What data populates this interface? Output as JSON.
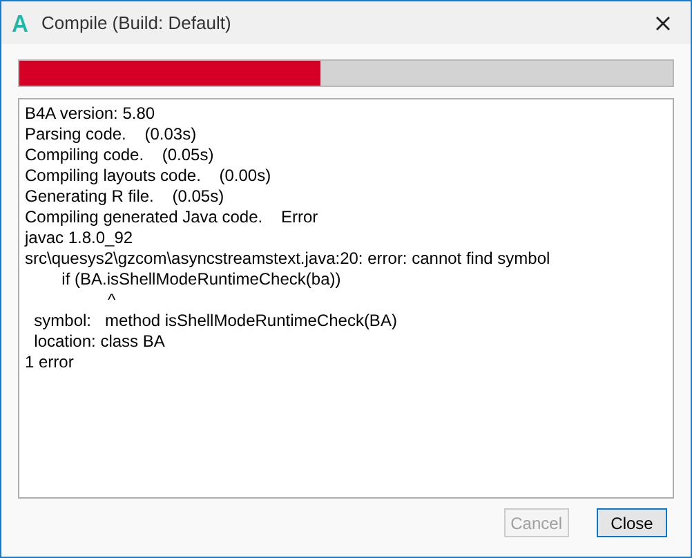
{
  "window": {
    "title": "Compile (Build: Default)"
  },
  "progress": {
    "level": 0.46
  },
  "log": [
    "B4A version: 5.80",
    "Parsing code.    (0.03s)",
    "Compiling code.    (0.05s)",
    "Compiling layouts code.    (0.00s)",
    "Generating R file.    (0.05s)",
    "Compiling generated Java code.    Error",
    "javac 1.8.0_92",
    "src\\quesys2\\gzcom\\asyncstreamstext.java:20: error: cannot find symbol",
    "        if (BA.isShellModeRuntimeCheck(ba))",
    "                  ^",
    "  symbol:   method isShellModeRuntimeCheck(BA)",
    "  location: class BA",
    "1 error"
  ],
  "buttons": [
    {
      "label": "Cancel",
      "disabled": true,
      "focused": false
    },
    {
      "label": "Close",
      "disabled": false,
      "focused": true
    }
  ]
}
